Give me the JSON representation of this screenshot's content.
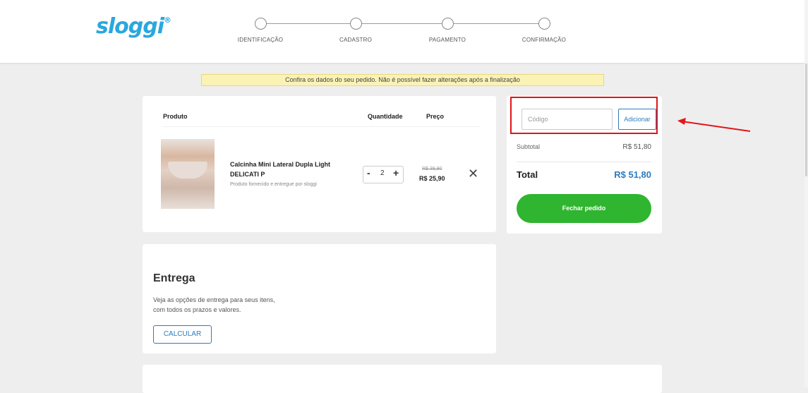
{
  "brand": {
    "logo_text": "sloggi",
    "logo_mark": "®",
    "color": "#2aa7df"
  },
  "steps": [
    {
      "label": "IDENTIFICAÇÃO"
    },
    {
      "label": "CADASTRO"
    },
    {
      "label": "PAGAMENTO"
    },
    {
      "label": "CONFIRMAÇÃO"
    }
  ],
  "notice": "Confira os dados do seu pedido. Não é possível fazer alterações após a finalização",
  "cart": {
    "headers": {
      "product": "Produto",
      "quantity": "Quantidade",
      "price": "Preço"
    },
    "item": {
      "name": "Calcinha Mini Lateral Dupla Light DELICATI P",
      "seller": "Produto fornecido e entregue por sloggi",
      "qty_minus": "-",
      "qty": "2",
      "qty_plus": "+",
      "old_price": "R$ 39,90",
      "price": "R$ 25,90",
      "remove": "✕"
    }
  },
  "delivery": {
    "title": "Entrega",
    "text_line1": "Veja as opções de entrega para seus itens,",
    "text_line2": "com todos os prazos e valores.",
    "button": "CALCULAR"
  },
  "summary": {
    "coupon_placeholder": "Código",
    "add_button": "Adicionar",
    "subtotal_label": "Subtotal",
    "subtotal_value": "R$ 51,80",
    "total_label": "Total",
    "total_value": "R$ 51,80",
    "checkout_button": "Fechar pedido"
  },
  "colors": {
    "accent": "#2d7cc1",
    "checkout": "#2fb52f",
    "highlight": "#e3141b",
    "notice_bg": "#fbf2b6"
  }
}
